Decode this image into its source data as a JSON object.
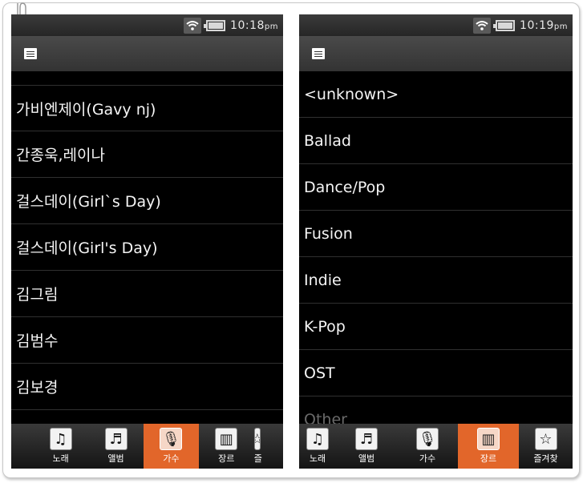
{
  "left": {
    "time": "10:18",
    "ampm": "pm",
    "rows": [
      "가비엔제이(Gavy nj)",
      "간종욱,레이나",
      "걸스데이(Girl`s Day)",
      "걸스데이(Girl's Day)",
      "김그림",
      "김범수",
      "김보경"
    ],
    "tabs": [
      {
        "label": "노래",
        "icon": "♫"
      },
      {
        "label": "앨범",
        "icon": "♬"
      },
      {
        "label": "가수",
        "icon": "🎙"
      },
      {
        "label": "장르",
        "icon": "▥"
      },
      {
        "label": "즐",
        "icon": "☆"
      }
    ]
  },
  "right": {
    "time": "10:19",
    "ampm": "pm",
    "rows": [
      "<unknown>",
      "Ballad",
      "Dance/Pop",
      "Fusion",
      "Indie",
      "K-Pop",
      "OST",
      "Other"
    ],
    "tabs": [
      {
        "label": "노래",
        "icon": "♫"
      },
      {
        "label": "앨범",
        "icon": "♬"
      },
      {
        "label": "가수",
        "icon": "🎙"
      },
      {
        "label": "장르",
        "icon": "▥"
      },
      {
        "label": "즐겨찾",
        "icon": "☆"
      }
    ]
  },
  "colors": {
    "accent": "#e2662a",
    "list_bg": "#000000",
    "divider": "#303030"
  },
  "icons": {
    "wifi": "wifi-icon",
    "battery": "battery-icon",
    "menu": "menu-icon"
  }
}
